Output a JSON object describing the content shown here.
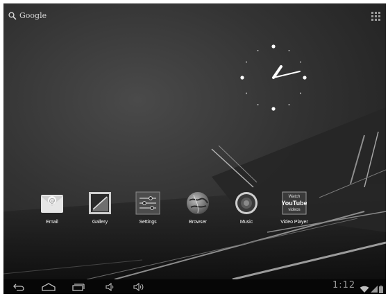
{
  "search": {
    "label": "Google",
    "icon": "search-icon"
  },
  "top_right": {
    "icon": "all-apps-icon"
  },
  "clock": {
    "type": "analog",
    "hour_hand_deg": 30,
    "minute_hand_deg": 72
  },
  "apps": [
    {
      "label": "Email",
      "icon": "email-icon"
    },
    {
      "label": "Gallery",
      "icon": "gallery-icon"
    },
    {
      "label": "Settings",
      "icon": "settings-icon"
    },
    {
      "label": "Browser",
      "icon": "browser-icon"
    },
    {
      "label": "Music",
      "icon": "music-icon"
    },
    {
      "label": "Video Player",
      "icon": "video-player-icon",
      "badge": {
        "line1": "Watch",
        "line2": "YouTube",
        "line3": "videos"
      }
    }
  ],
  "navbar": {
    "buttons": [
      "back-icon",
      "home-icon",
      "recent-apps-icon",
      "volume-down-icon",
      "volume-up-icon"
    ],
    "time": "1:12",
    "status": [
      "wifi-icon",
      "signal-icon",
      "battery-icon"
    ]
  },
  "colors": {
    "navbar": "#060606",
    "text": "#ffffff",
    "time": "#9a9a9a"
  }
}
